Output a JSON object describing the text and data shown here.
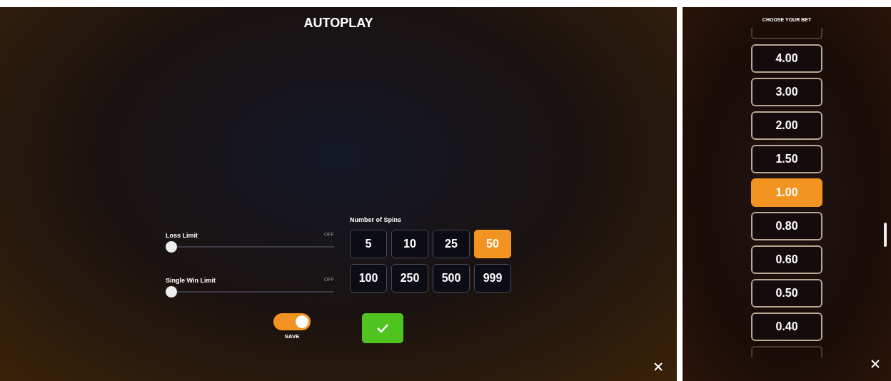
{
  "autoplay": {
    "title": "AUTOPLAY",
    "limits": [
      {
        "label": "Loss Limit",
        "reading": "OFF",
        "level": 0
      },
      {
        "label": "Single Win Limit",
        "reading": "OFF",
        "level": 0
      }
    ],
    "spins": {
      "label": "Number of Spins",
      "options": [
        {
          "label": "5",
          "selected": false
        },
        {
          "label": "10",
          "selected": false
        },
        {
          "label": "25",
          "selected": false
        },
        {
          "label": "50",
          "selected": true
        },
        {
          "label": "100",
          "selected": false
        },
        {
          "label": "250",
          "selected": false
        },
        {
          "label": "500",
          "selected": false
        },
        {
          "label": "999",
          "selected": false
        }
      ]
    },
    "toggle": {
      "label": "SAVE",
      "on": true
    }
  },
  "bet_panel": {
    "title": "CHOOSE YOUR BET",
    "bets": [
      {
        "label": "4.00",
        "selected": false
      },
      {
        "label": "3.00",
        "selected": false
      },
      {
        "label": "2.00",
        "selected": false
      },
      {
        "label": "1.50",
        "selected": false
      },
      {
        "label": "1.00",
        "selected": true
      },
      {
        "label": "0.80",
        "selected": false
      },
      {
        "label": "0.60",
        "selected": false
      },
      {
        "label": "0.50",
        "selected": false
      },
      {
        "label": "0.40",
        "selected": false
      }
    ]
  }
}
